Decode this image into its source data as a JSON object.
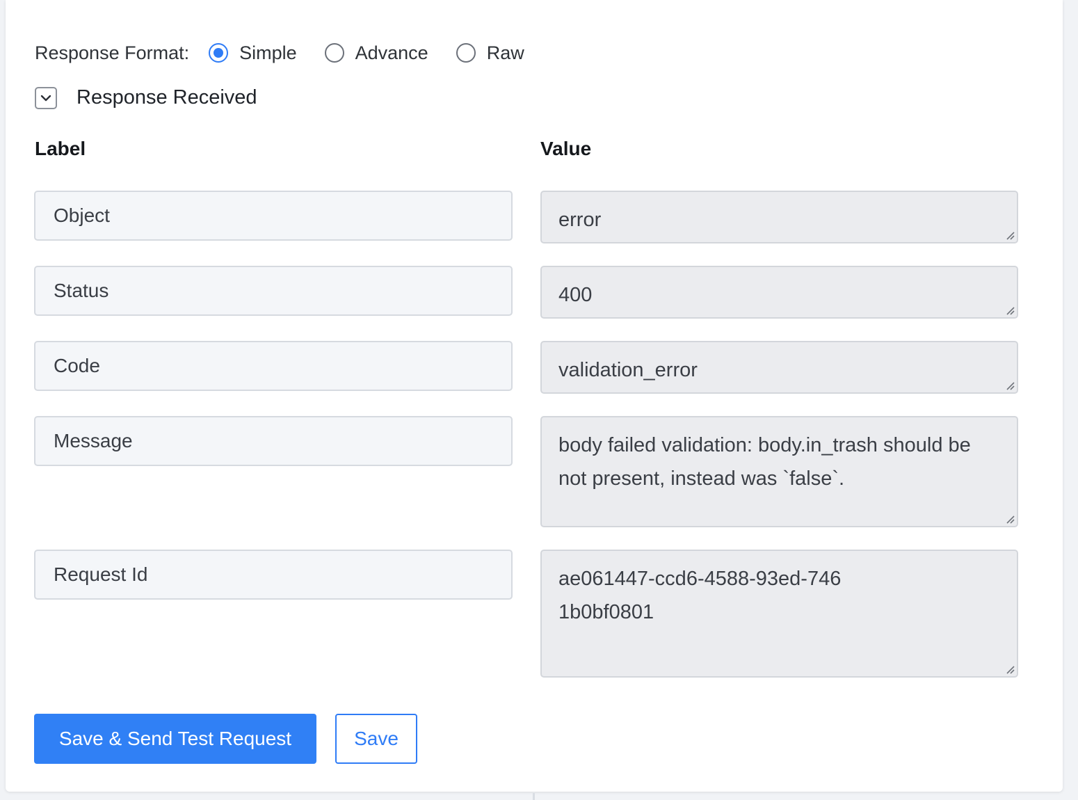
{
  "response_format": {
    "label": "Response Format:",
    "options": [
      {
        "label": "Simple",
        "selected": true
      },
      {
        "label": "Advance",
        "selected": false
      },
      {
        "label": "Raw",
        "selected": false
      }
    ]
  },
  "response_section": {
    "title": "Response Received",
    "expanded": true
  },
  "columns": {
    "label_header": "Label",
    "value_header": "Value"
  },
  "rows": [
    {
      "label": "Object",
      "value": "error"
    },
    {
      "label": "Status",
      "value": "400"
    },
    {
      "label": "Code",
      "value": "validation_error"
    },
    {
      "label": "Message",
      "value": "body failed validation: body.in_trash should be not present, instead was `false`."
    },
    {
      "label": "Request Id",
      "value": "ae061447-ccd6-4588-93ed-7461b0bf0801"
    }
  ],
  "actions": {
    "save_and_send_label": "Save & Send Test Request",
    "save_label": "Save"
  },
  "colors": {
    "accent": "#3080f5"
  },
  "icons": {
    "collapse": "chevron-down-icon",
    "resize": "resize-grip-icon"
  }
}
